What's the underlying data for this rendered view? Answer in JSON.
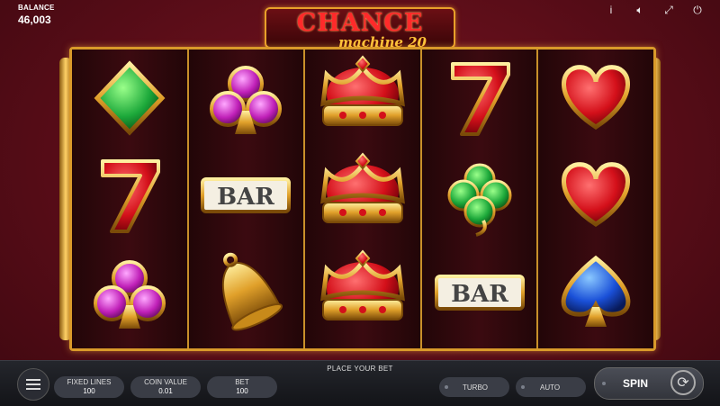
{
  "header": {
    "balance_label": "BALANCE",
    "balance_value": "46,003",
    "icons": [
      "info-icon",
      "sound-icon",
      "fullscreen-icon",
      "power-icon"
    ]
  },
  "logo": {
    "title": "CHANCE",
    "subtitle": "machine 20"
  },
  "reels": [
    [
      "green-diamond",
      "red-seven",
      "purple-club"
    ],
    [
      "purple-club",
      "bar",
      "golden-bell"
    ],
    [
      "crown",
      "crown",
      "crown"
    ],
    [
      "red-seven",
      "green-clover",
      "bar"
    ],
    [
      "red-heart",
      "red-heart",
      "blue-spade"
    ]
  ],
  "symbol_text": {
    "bar": "BAR",
    "seven": "7"
  },
  "controls": {
    "place_bet": "PLACE YOUR BET",
    "fixed_lines_label": "FIXED LINES",
    "fixed_lines_value": "100",
    "coin_value_label": "COIN VALUE",
    "coin_value_value": "0.01",
    "bet_label": "BET",
    "bet_value": "100",
    "turbo_label": "TURBO",
    "auto_label": "AUTO",
    "spin_label": "SPIN"
  },
  "colors": {
    "background": "#5a0d18",
    "frame_gold": "#d99a2a",
    "bar_dark": "#1a1b20"
  }
}
